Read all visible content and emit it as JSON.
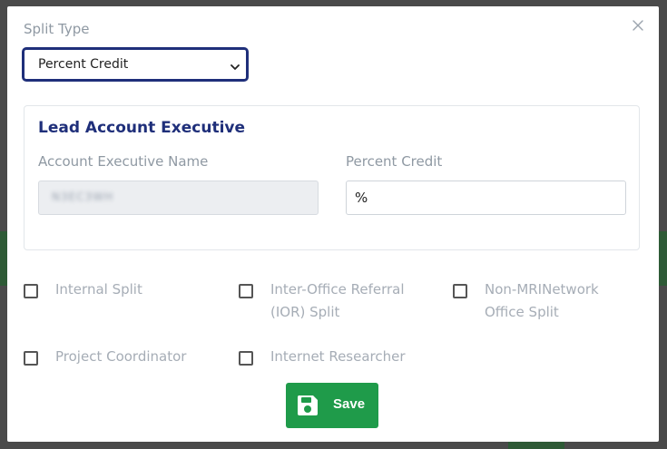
{
  "modal": {
    "close_icon": "close-icon",
    "split_type_label": "Split Type",
    "split_type_value": "Percent Credit",
    "card": {
      "title": "Lead Account Executive",
      "ae_name_label": "Account Executive Name",
      "ae_name_value": "N3EC3WH",
      "percent_label": "Percent Credit",
      "percent_value": "%"
    },
    "checkboxes": [
      {
        "label": "Internal Split",
        "checked": false
      },
      {
        "label": "Inter-Office Referral (IOR) Split",
        "checked": false
      },
      {
        "label": "Non-MRINetwork Office Split",
        "checked": false
      },
      {
        "label": "Project Coordinator",
        "checked": false
      },
      {
        "label": "Internet Researcher",
        "checked": false
      }
    ],
    "save_label": "Save",
    "save_icon": "floppy-disk-icon",
    "colors": {
      "accent_navy": "#1f2f7a",
      "save_green": "#1f9b4a",
      "muted_text": "#8f99a3"
    }
  }
}
